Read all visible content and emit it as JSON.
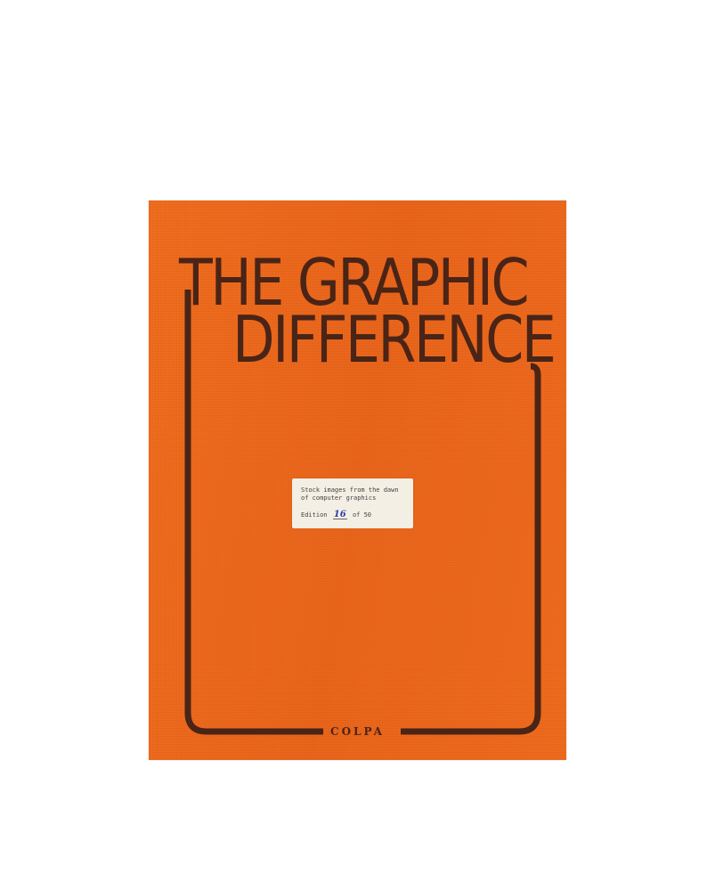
{
  "cover": {
    "title_line_1": "THE GRAPHIC",
    "title_line_2": "DIFFERENCE",
    "publisher": "COLPA",
    "colors": {
      "background": "#ee6a1c",
      "ink": "#4a2416",
      "label": "#f4efe4",
      "handwriting": "#2a3fb0"
    }
  },
  "label": {
    "line_1": "Stock images from the dawn",
    "line_2": "of computer graphics",
    "edition_prefix": "Edition",
    "edition_number": "16",
    "edition_suffix": "of 50"
  }
}
